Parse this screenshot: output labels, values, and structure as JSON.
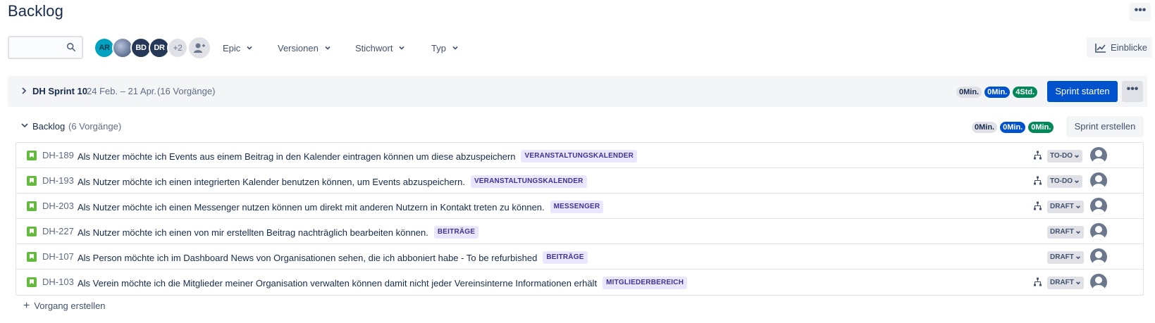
{
  "page": {
    "title": "Backlog",
    "more_label": "•••"
  },
  "toolbar": {
    "search": {
      "value": "",
      "placeholder": ""
    },
    "avatars": [
      {
        "initials": "AR"
      },
      {
        "initials": ""
      },
      {
        "initials": "BD"
      },
      {
        "initials": "DR"
      },
      {
        "initials": "+2"
      }
    ],
    "filters": [
      {
        "label": "Epic"
      },
      {
        "label": "Versionen"
      },
      {
        "label": "Stichwort"
      },
      {
        "label": "Typ"
      }
    ],
    "insights_label": "Einblicke"
  },
  "sprint": {
    "name": "DH Sprint 10",
    "dates": "24 Feb. – 21 Apr.",
    "count": "(16 Vorgänge)",
    "estimates": {
      "todo": "0Min.",
      "in_progress": "0Min.",
      "done": "4Std."
    },
    "start_label": "Sprint starten",
    "more_label": "•••"
  },
  "backlog": {
    "name": "Backlog",
    "count": "(6 Vorgänge)",
    "estimates": {
      "todo": "0Min.",
      "in_progress": "0Min.",
      "done": "0Min."
    },
    "create_sprint_label": "Sprint erstellen",
    "issues": [
      {
        "key": "DH-189",
        "summary": "Als Nutzer möchte ich Events aus einem Beitrag in den Kalender eintragen können um diese abzuspeichern",
        "epic": "VERANSTALTUNGSKALENDER",
        "status": "TO-DO",
        "has_child": true
      },
      {
        "key": "DH-193",
        "summary": "Als Nutzer möchte ich einen integrierten Kalender benutzen können, um Events abzuspeichern.",
        "epic": "VERANSTALTUNGSKALENDER",
        "status": "TO-DO",
        "has_child": true
      },
      {
        "key": "DH-203",
        "summary": "Als Nutzer möchte ich einen Messenger nutzen können um direkt mit anderen Nutzern in Kontakt treten zu können.",
        "epic": "MESSENGER",
        "status": "DRAFT",
        "has_child": true
      },
      {
        "key": "DH-227",
        "summary": "Als Nutzer möchte ich einen von mir erstellten Beitrag nachträglich bearbeiten können.",
        "epic": "BEITRÄGE",
        "status": "DRAFT",
        "has_child": false
      },
      {
        "key": "DH-107",
        "summary": "Als Person möchte ich im Dashboard News von Organisationen sehen, die ich abboniert habe - To be refurbished",
        "epic": "BEITRÄGE",
        "status": "DRAFT",
        "has_child": false
      },
      {
        "key": "DH-103",
        "summary": "Als Verein möchte ich die Mitglieder meiner Organisation verwalten können damit nicht jeder Vereinsinterne Informationen erhält",
        "epic": "MITGLIEDERBEREICH",
        "status": "DRAFT",
        "has_child": true
      }
    ],
    "create_issue_label": "Vorgang erstellen"
  },
  "icons": {
    "search": "search-icon",
    "add_people": "add-people-icon",
    "chevron": "chevron-down-icon",
    "insights": "chart-line-icon",
    "story": "story-icon",
    "child_issues": "child-issues-icon",
    "assignee": "unassigned-avatar-icon",
    "plus": "plus-icon"
  },
  "colors": {
    "primary": "#0052cc",
    "done": "#00875a",
    "story": "#63ba3c",
    "epic_bg": "#eae6ff",
    "epic_text": "#403294"
  }
}
